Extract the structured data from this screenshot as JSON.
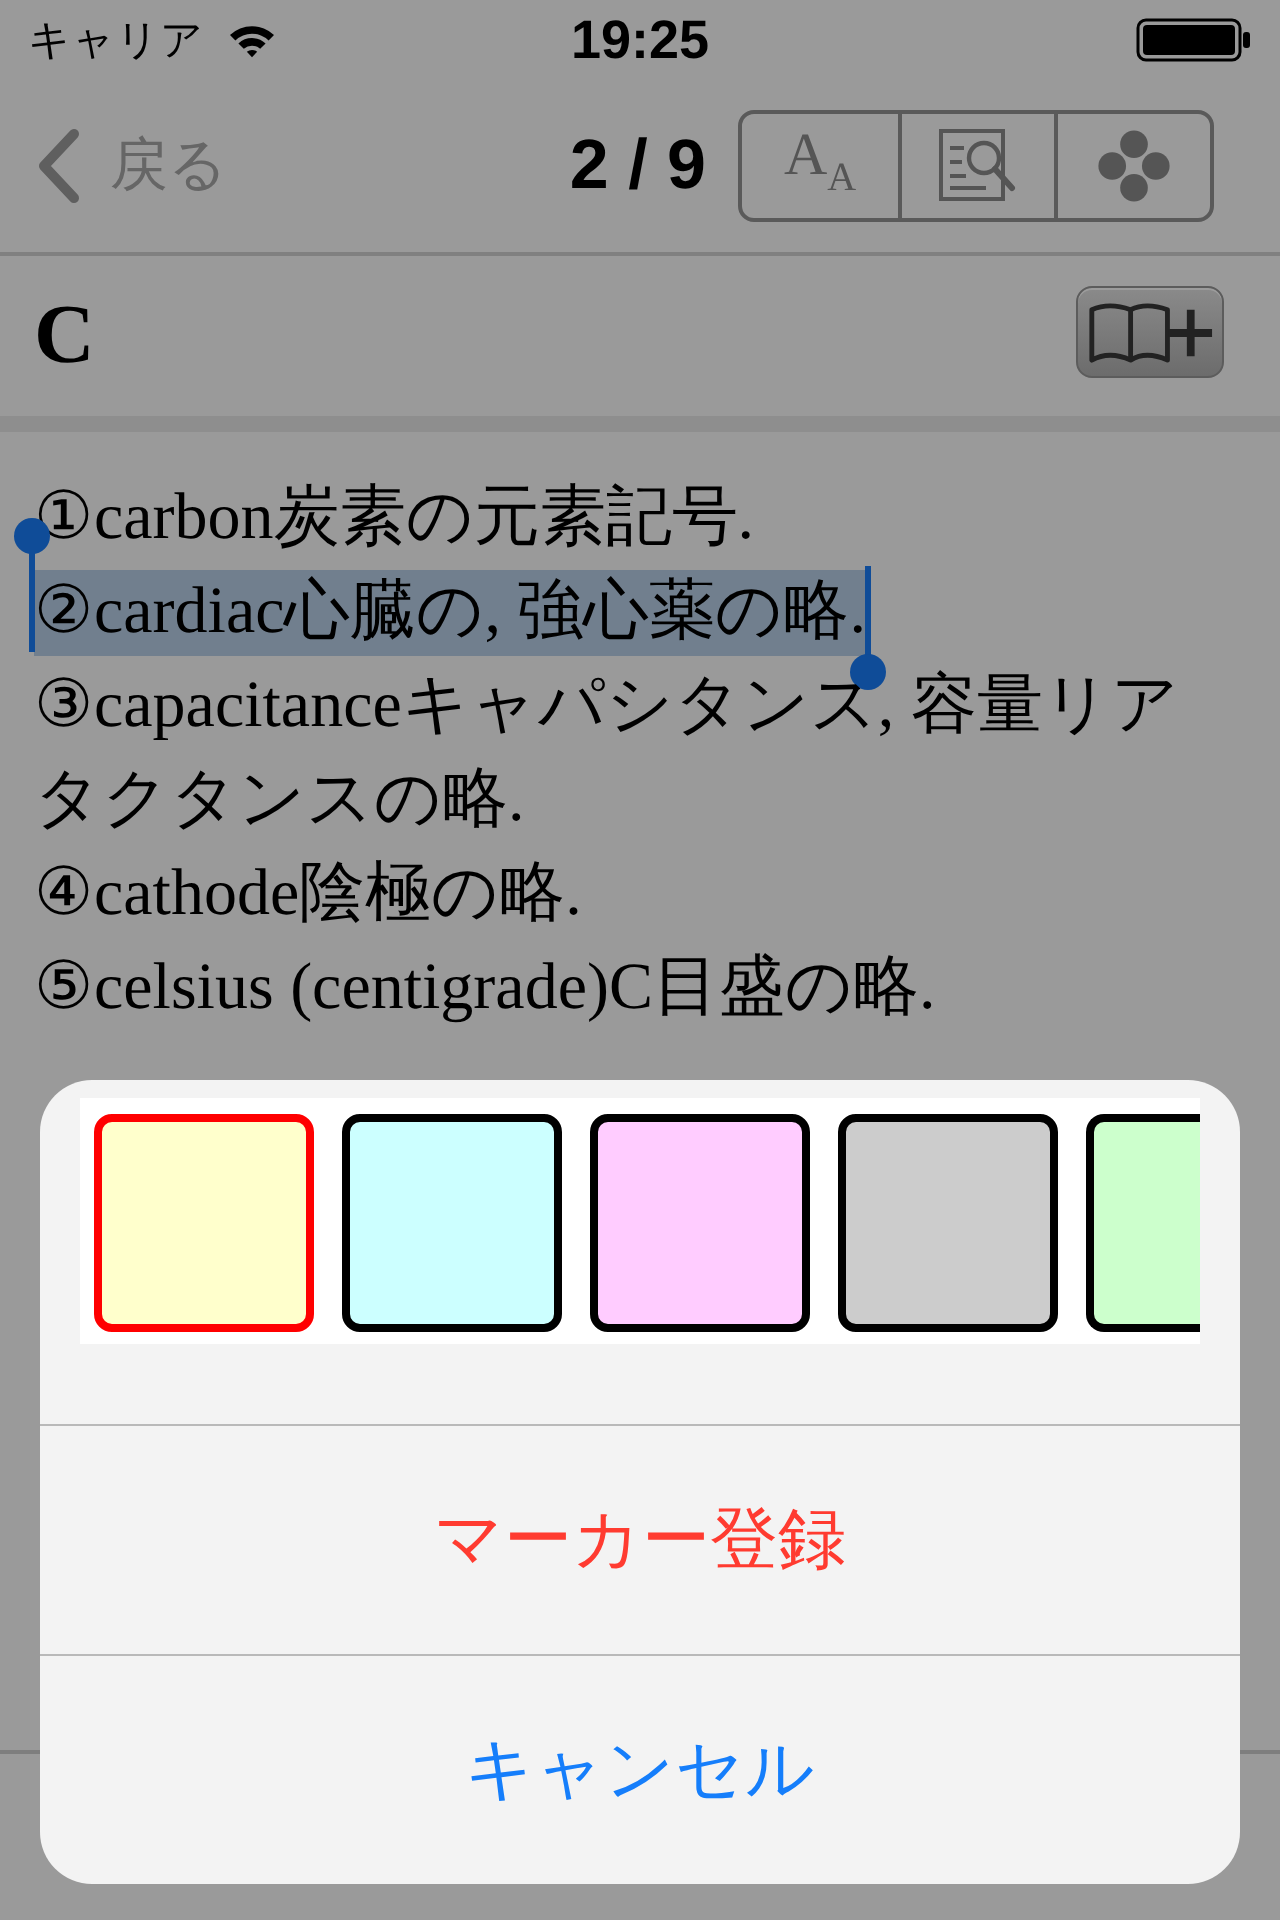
{
  "status_bar": {
    "carrier": "キャリア",
    "time": "19:25"
  },
  "nav_bar": {
    "back_label": "戻る",
    "page_counter": "2 / 9",
    "tools": [
      {
        "kind": "font-size",
        "label": "A$_{A}$"
      },
      {
        "kind": "search-document"
      },
      {
        "kind": "clover"
      }
    ]
  },
  "header": {
    "title": "C"
  },
  "entries": [
    {
      "text": "①carbon炭素の元素記号.",
      "selected": false
    },
    {
      "text": "②cardiac心臓の, 強心薬の略.",
      "selected": true
    },
    {
      "text": "③capacitanceキャパシタンス, 容量リアタクタンスの略.",
      "selected": false
    },
    {
      "text": "④cathode陰極の略.",
      "selected": false
    },
    {
      "text": "⑤celsius (centigrade)C目盛の略.",
      "selected": false
    }
  ],
  "action_sheet": {
    "swatches": [
      {
        "color": "#ffffcc",
        "selected": true
      },
      {
        "color": "#ccffff",
        "selected": false
      },
      {
        "color": "#ffccff",
        "selected": false
      },
      {
        "color": "#cccccc",
        "selected": false
      },
      {
        "color": "#ccffcc",
        "selected": false
      }
    ],
    "actions": [
      {
        "kind": "destructive",
        "label": "マーカー登録"
      },
      {
        "kind": "cancel",
        "label": "キャンセル"
      }
    ]
  }
}
